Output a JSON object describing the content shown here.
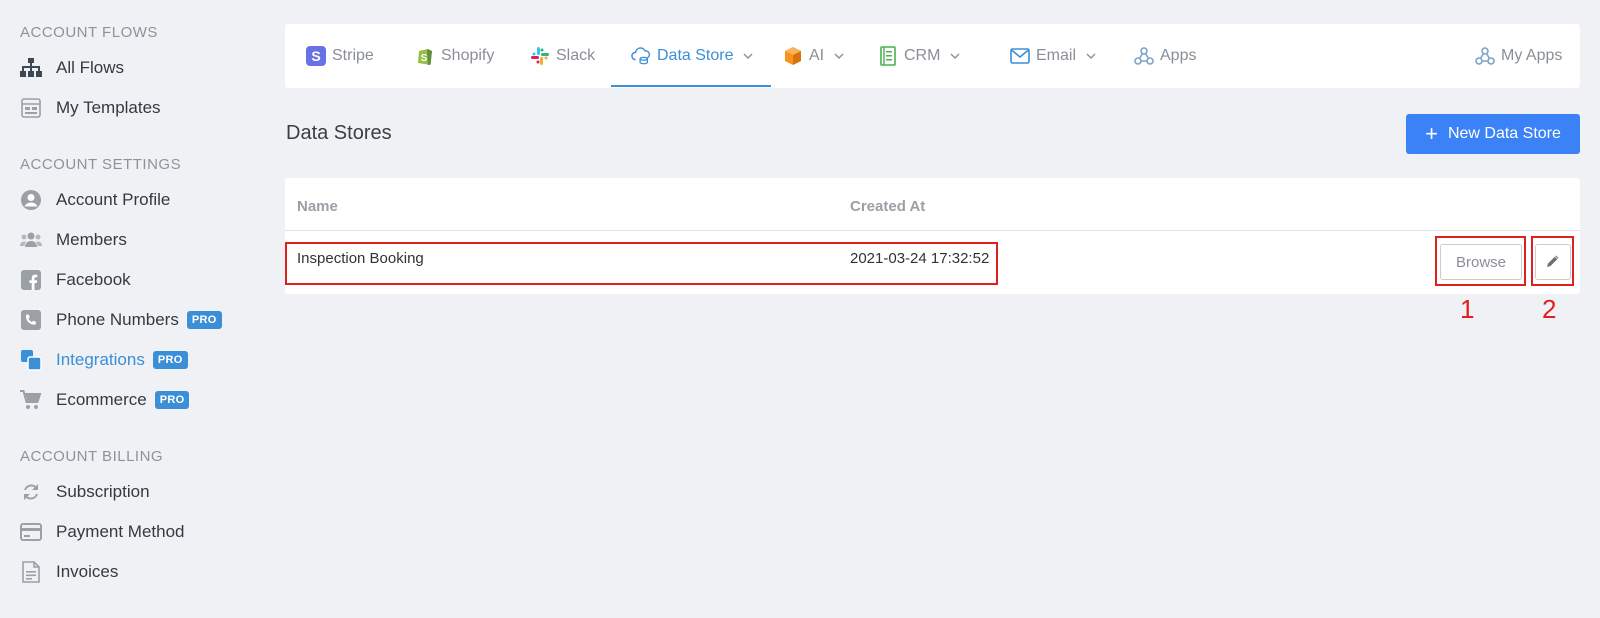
{
  "sidebar": {
    "flows_title": "ACCOUNT FLOWS",
    "flows_items": [
      {
        "label": "All Flows",
        "icon": "sitemap-icon"
      },
      {
        "label": "My Templates",
        "icon": "template-icon"
      }
    ],
    "settings_title": "ACCOUNT SETTINGS",
    "settings_items": [
      {
        "label": "Account Profile",
        "icon": "user-circle-icon"
      },
      {
        "label": "Members",
        "icon": "users-icon"
      },
      {
        "label": "Facebook",
        "icon": "facebook-icon"
      },
      {
        "label": "Phone Numbers",
        "icon": "phone-icon",
        "badge": "PRO"
      },
      {
        "label": "Integrations",
        "icon": "integrations-icon",
        "badge": "PRO",
        "active": true
      },
      {
        "label": "Ecommerce",
        "icon": "cart-icon",
        "badge": "PRO"
      }
    ],
    "billing_title": "ACCOUNT BILLING",
    "billing_items": [
      {
        "label": "Subscription",
        "icon": "refresh-icon"
      },
      {
        "label": "Payment Method",
        "icon": "credit-card-icon"
      },
      {
        "label": "Invoices",
        "icon": "invoice-icon"
      }
    ]
  },
  "tabs": {
    "stripe": "Stripe",
    "shopify": "Shopify",
    "slack": "Slack",
    "data_store": "Data Store",
    "ai": "AI",
    "crm": "CRM",
    "email": "Email",
    "apps": "Apps",
    "my_apps": "My Apps"
  },
  "page": {
    "title": "Data Stores",
    "new_button": "New Data Store"
  },
  "table": {
    "columns": [
      "Name",
      "Created At"
    ],
    "rows": [
      {
        "name": "Inspection Booking",
        "created_at": "2021-03-24 17:32:52",
        "browse": "Browse"
      }
    ]
  },
  "annotations": [
    "1",
    "2"
  ],
  "colors": {
    "accent": "#3b8fd6",
    "primary_button": "#3b82f6",
    "annotation_red": "#e0201c"
  }
}
